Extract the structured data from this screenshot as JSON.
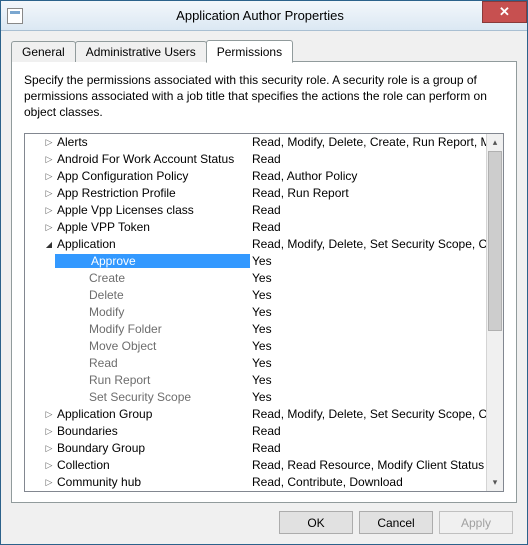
{
  "window": {
    "title": "Application Author Properties"
  },
  "tabs": {
    "general": "General",
    "admin_users": "Administrative Users",
    "permissions": "Permissions"
  },
  "panel": {
    "description": "Specify the permissions associated with this security role. A security role is a group of permissions associated with a job title that specifies the actions the role can perform on object classes."
  },
  "rows": [
    {
      "name": "Alerts",
      "val": "Read, Modify, Delete, Create, Run Report, M",
      "exp": "right"
    },
    {
      "name": "Android For Work Account Status",
      "val": "Read",
      "exp": "right"
    },
    {
      "name": "App Configuration Policy",
      "val": "Read, Author Policy",
      "exp": "right"
    },
    {
      "name": "App Restriction Profile",
      "val": "Read, Run Report",
      "exp": "right"
    },
    {
      "name": "Apple Vpp Licenses class",
      "val": "Read",
      "exp": "right"
    },
    {
      "name": "Apple VPP Token",
      "val": "Read",
      "exp": "right"
    },
    {
      "name": "Application",
      "val": "Read, Modify, Delete, Set Security Scope, Cr",
      "exp": "down"
    }
  ],
  "children": [
    {
      "name": "Approve",
      "val": "Yes",
      "selected": true
    },
    {
      "name": "Create",
      "val": "Yes"
    },
    {
      "name": "Delete",
      "val": "Yes"
    },
    {
      "name": "Modify",
      "val": "Yes"
    },
    {
      "name": "Modify Folder",
      "val": "Yes"
    },
    {
      "name": "Move Object",
      "val": "Yes"
    },
    {
      "name": "Read",
      "val": "Yes"
    },
    {
      "name": "Run Report",
      "val": "Yes"
    },
    {
      "name": "Set Security Scope",
      "val": "Yes"
    }
  ],
  "rows2": [
    {
      "name": "Application Group",
      "val": "Read, Modify, Delete, Set Security Scope, Cr",
      "exp": "right"
    },
    {
      "name": "Boundaries",
      "val": "Read",
      "exp": "right"
    },
    {
      "name": "Boundary Group",
      "val": "Read",
      "exp": "right"
    },
    {
      "name": "Collection",
      "val": "Read, Read Resource, Modify Client Status A",
      "exp": "right"
    },
    {
      "name": "Community hub",
      "val": "Read, Contribute, Download",
      "exp": "right",
      "cut": true
    }
  ],
  "buttons": {
    "ok": "OK",
    "cancel": "Cancel",
    "apply": "Apply"
  }
}
